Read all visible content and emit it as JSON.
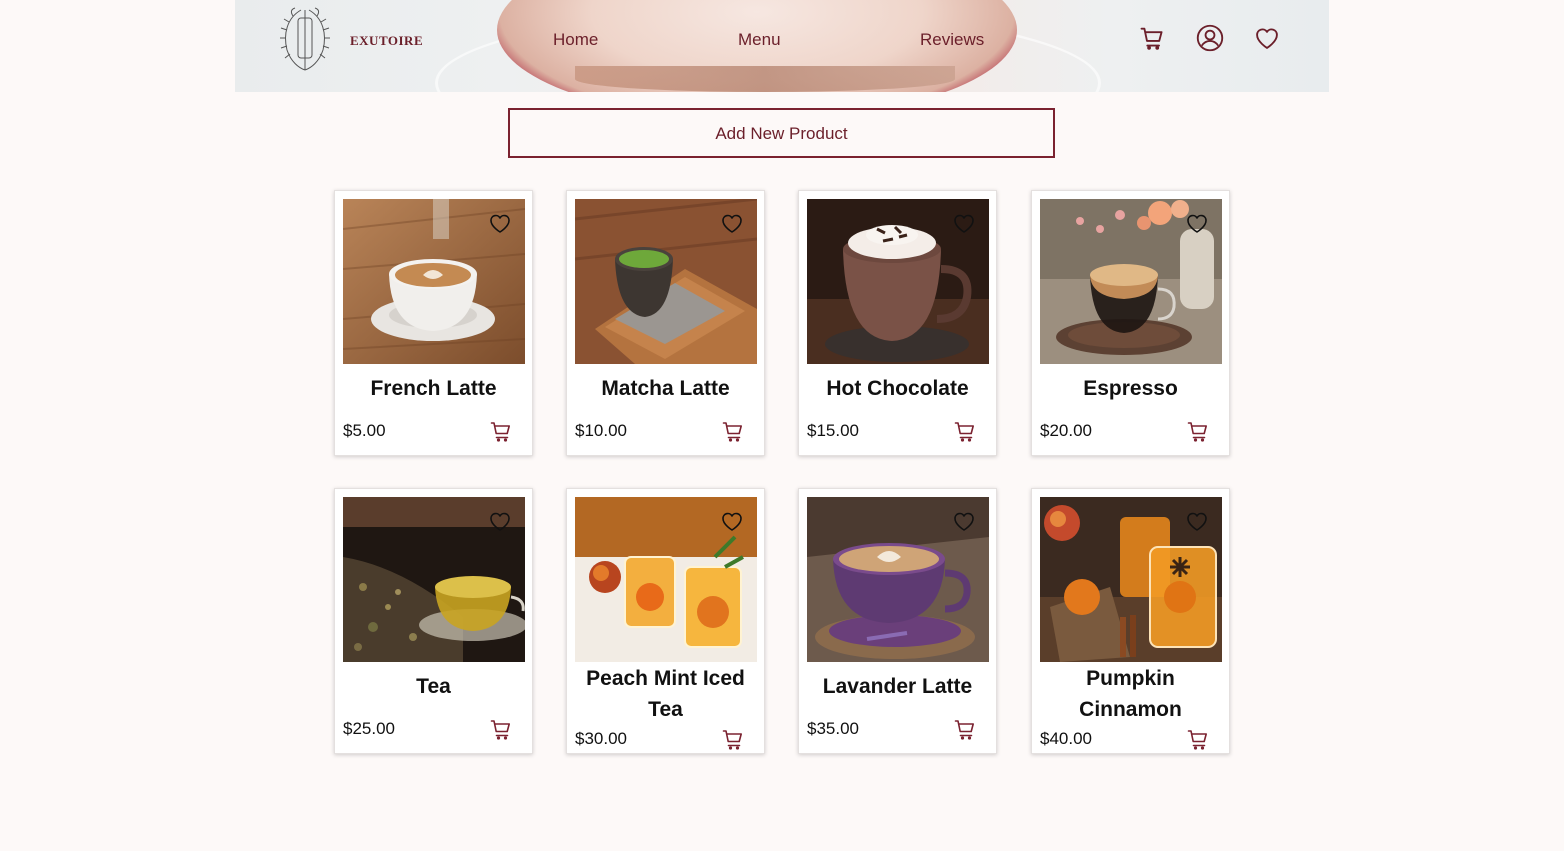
{
  "header": {
    "brand": "EXUTOIRE",
    "nav": [
      {
        "label": "Home"
      },
      {
        "label": "Menu"
      },
      {
        "label": "Reviews"
      }
    ],
    "icons": [
      "cart-icon",
      "user-icon",
      "heart-icon"
    ]
  },
  "actions": {
    "add_product_label": "Add New Product"
  },
  "colors": {
    "accent": "#7b2230",
    "background": "#fdf9f8",
    "card": "#ffffff"
  },
  "products": [
    {
      "name": "French Latte",
      "price": "$5.00"
    },
    {
      "name": "Matcha Latte",
      "price": "$10.00"
    },
    {
      "name": "Hot Chocolate",
      "price": "$15.00"
    },
    {
      "name": "Espresso",
      "price": "$20.00"
    },
    {
      "name": "Tea",
      "price": "$25.00"
    },
    {
      "name": "Peach Mint Iced Tea",
      "price": "$30.00"
    },
    {
      "name": "Lavander Latte",
      "price": "$35.00"
    },
    {
      "name": "Pumpkin Cinnamon",
      "price": "$40.00"
    }
  ]
}
